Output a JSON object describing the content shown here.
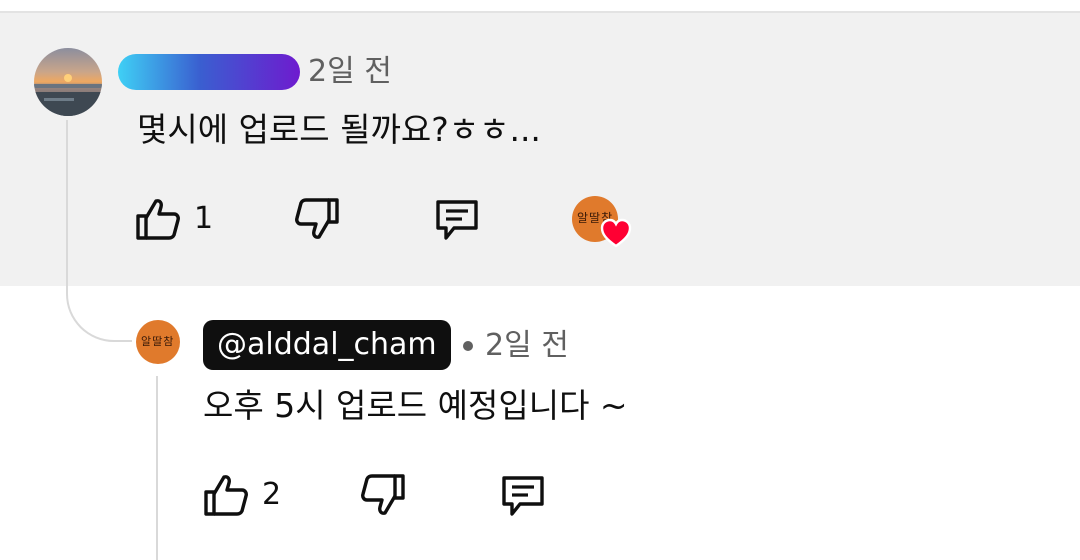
{
  "comment": {
    "time": "2일 전",
    "text": "몇시에 업로드 될까요?ㅎㅎ...",
    "actions": {
      "like_icon": "thumbs-up-icon",
      "like_count": "1",
      "dislike_icon": "thumbs-down-icon",
      "reply_icon": "reply-comment-icon"
    },
    "creator_heart": {
      "avatar_text": "알딸참",
      "icon": "heart-icon",
      "heart_color": "#ff0033"
    }
  },
  "reply": {
    "author": "@alddal_cham",
    "time": "2일 전",
    "text": "오후 5시 업로드 예정입니다 ~",
    "avatar_text": "알딸참",
    "actions": {
      "like_count": "2"
    }
  },
  "colors": {
    "highlight_bg": "#f1f1f1",
    "creator_badge_bg": "#0f0f0f",
    "avatar_orange": "#e07a2c",
    "meta_text": "#606060"
  }
}
